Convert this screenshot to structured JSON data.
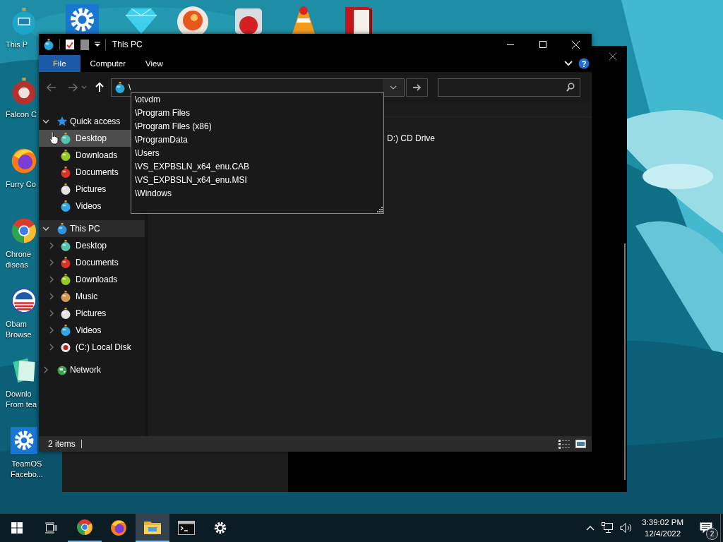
{
  "desktop_icons": [
    {
      "kind": "pc",
      "lines": [
        "This P"
      ]
    },
    {
      "kind": "ornament",
      "lines": [
        "Falcon C"
      ]
    },
    {
      "kind": "firefox",
      "lines": [
        "Furry Co"
      ]
    },
    {
      "kind": "chrome",
      "lines": [
        "Chrone",
        "diseas"
      ]
    },
    {
      "kind": "stripes",
      "lines": [
        "Obam",
        "Browse"
      ]
    },
    {
      "kind": "notes",
      "lines": [
        "Downlo",
        "From tea"
      ]
    },
    {
      "kind": "gear",
      "lines": [
        "TeamOS",
        "Facebo..."
      ]
    }
  ],
  "explorer": {
    "title": "This PC",
    "ribbon_tabs": [
      {
        "label": "File",
        "selected": true
      },
      {
        "label": "Computer",
        "selected": false
      },
      {
        "label": "View",
        "selected": false
      }
    ],
    "address": {
      "value": "\\"
    },
    "autocomplete": [
      {
        "label": "\\otvdm"
      },
      {
        "label": "\\Program Files"
      },
      {
        "label": "\\Program Files (x86)"
      },
      {
        "label": "\\ProgramData"
      },
      {
        "label": "\\Users"
      },
      {
        "label": "\\VS_EXPBSLN_x64_enu.CAB"
      },
      {
        "label": "\\VS_EXPBSLN_x64_enu.MSI"
      },
      {
        "label": "\\Windows"
      }
    ],
    "sidebar": [
      {
        "kind": "star",
        "label": "Quick access",
        "expanded": true,
        "selected": false,
        "children": [
          {
            "kind": "desktop",
            "label": "Desktop",
            "hovered": true
          },
          {
            "kind": "downloads",
            "label": "Downloads",
            "hovered": false
          },
          {
            "kind": "documents",
            "label": "Documents",
            "hovered": false
          },
          {
            "kind": "pictures",
            "label": "Pictures",
            "hovered": false
          },
          {
            "kind": "videos",
            "label": "Videos",
            "hovered": false
          }
        ]
      },
      {
        "kind": "pc",
        "label": "This PC",
        "expanded": true,
        "selected": true,
        "children": [
          {
            "kind": "desktop",
            "label": "Desktop",
            "expanded": false
          },
          {
            "kind": "documents",
            "label": "Documents",
            "expanded": false
          },
          {
            "kind": "downloads",
            "label": "Downloads",
            "expanded": false
          },
          {
            "kind": "music",
            "label": "Music",
            "expanded": false
          },
          {
            "kind": "pictures",
            "label": "Pictures",
            "expanded": false
          },
          {
            "kind": "videos",
            "label": "Videos",
            "expanded": false
          },
          {
            "kind": "disk",
            "label": "(C:) Local Disk",
            "expanded": false
          }
        ]
      },
      {
        "kind": "network",
        "label": "Network",
        "expanded": false,
        "selected": false
      }
    ],
    "content": {
      "items": [
        {
          "label": "D:) CD Drive"
        }
      ]
    },
    "status_bar": {
      "count": "2 items"
    }
  },
  "taskbar": {
    "apps": [
      {
        "kind": "chrome",
        "running": true,
        "active": false
      },
      {
        "kind": "firefox",
        "running": false,
        "active": false
      },
      {
        "kind": "explorer",
        "running": true,
        "active": true
      },
      {
        "kind": "terminal",
        "running": false,
        "active": false
      },
      {
        "kind": "settings",
        "running": false,
        "active": false
      }
    ],
    "clock": {
      "time": "3:39:02 PM",
      "date": "12/4/2022"
    },
    "notifications": {
      "count": "2"
    }
  }
}
